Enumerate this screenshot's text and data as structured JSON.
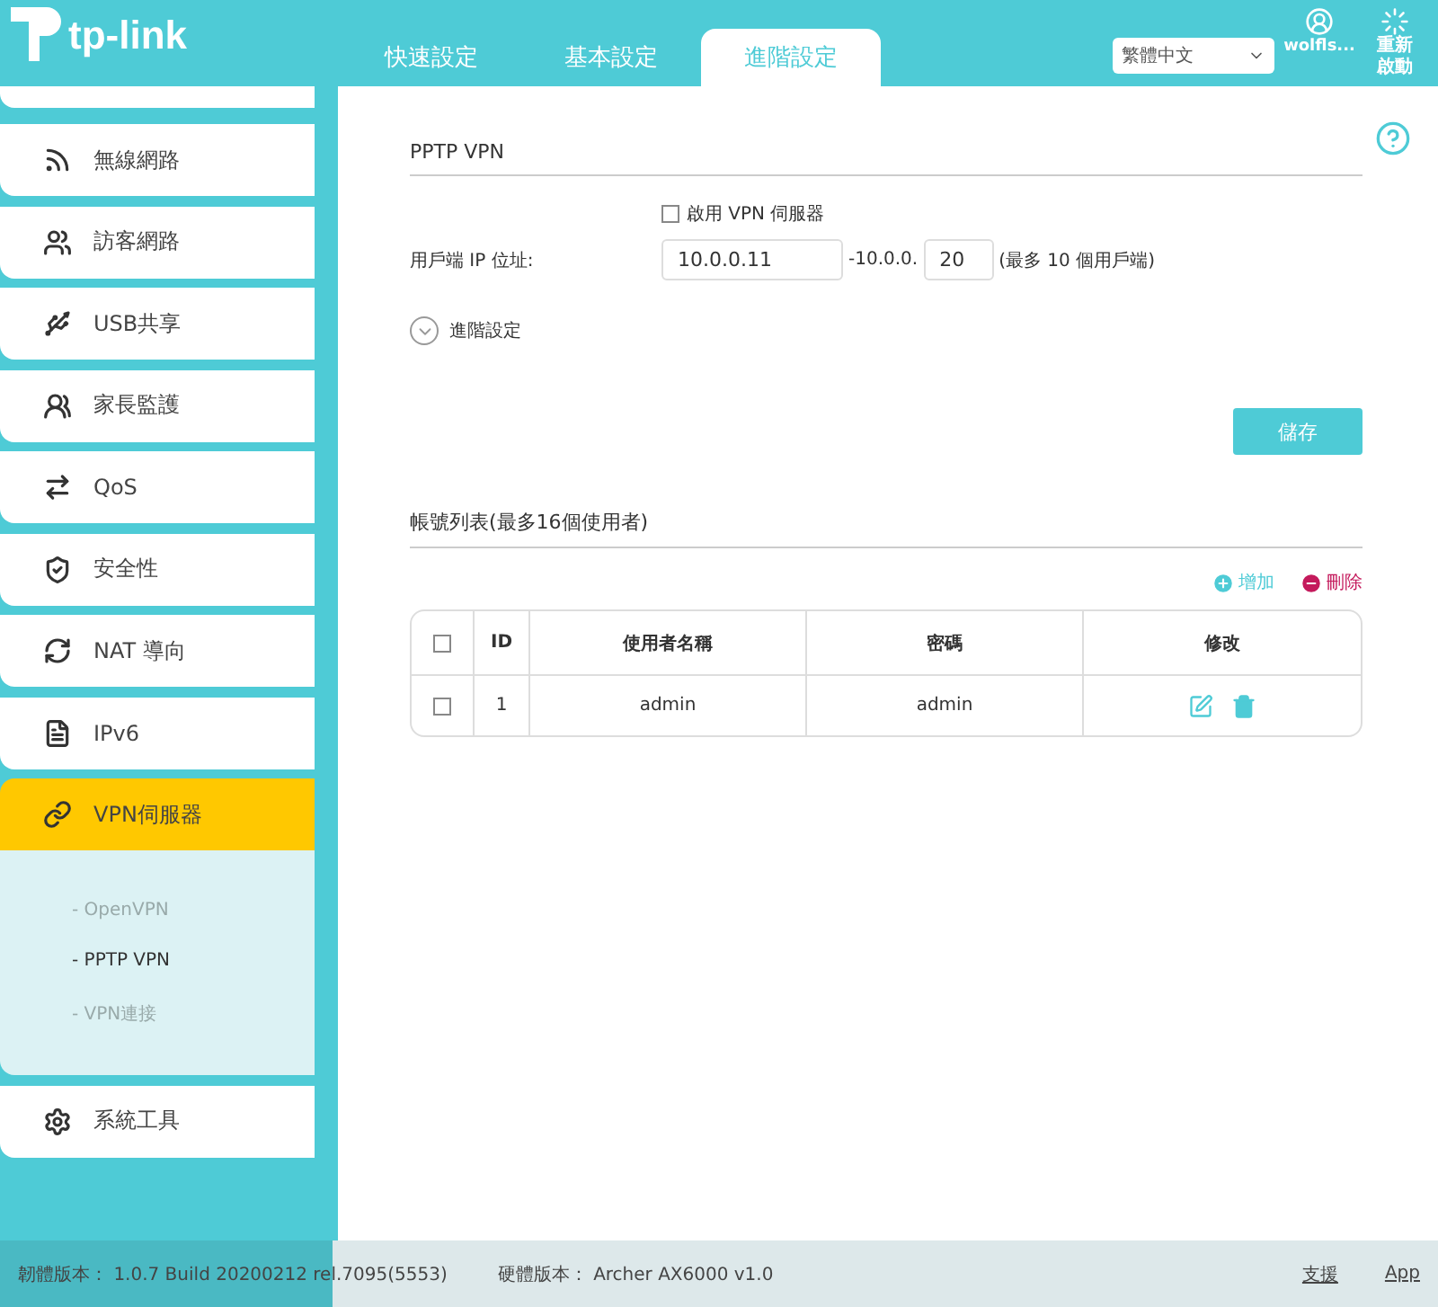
{
  "logo": {
    "text": "tp-link"
  },
  "nav_tabs": [
    {
      "label": "快速設定",
      "selected": false
    },
    {
      "label": "基本設定",
      "selected": false
    },
    {
      "label": "進階設定",
      "selected": true
    }
  ],
  "language_select": {
    "value": "繁體中文"
  },
  "header_actions": [
    {
      "kind": "account",
      "label": "wolfls..."
    },
    {
      "kind": "reboot",
      "label": "重新啟動"
    }
  ],
  "sidebar": {
    "items": [
      {
        "label": "無線網路",
        "selected": false
      },
      {
        "label": "訪客網路",
        "selected": false
      },
      {
        "label": "USB共享",
        "selected": false
      },
      {
        "label": "家長監護",
        "selected": false
      },
      {
        "label": "QoS",
        "selected": false
      },
      {
        "label": "安全性",
        "selected": false
      },
      {
        "label": "NAT 導向",
        "selected": false
      },
      {
        "label": "IPv6",
        "selected": false
      },
      {
        "label": "VPN伺服器",
        "selected": true,
        "expanded": true,
        "children": [
          {
            "label": "- OpenVPN",
            "selected": false
          },
          {
            "label": "- PPTP VPN",
            "selected": true
          },
          {
            "label": "- VPN連接",
            "selected": false
          }
        ]
      },
      {
        "label": "系統工具",
        "selected": false
      }
    ]
  },
  "pptp": {
    "title": "PPTP VPN",
    "enable_checkbox": {
      "label": "啟用 VPN 伺服器",
      "checked": false
    },
    "client_ip": {
      "label": "用戶端 IP 位址:",
      "start": "10.0.0.11",
      "range_prefix": "-10.0.0.",
      "end": "20",
      "note": "(最多 10 個用戶端)"
    },
    "advanced": {
      "label": "進階設定",
      "expanded": false
    },
    "save_button": "儲存"
  },
  "accounts": {
    "title": "帳號列表(最多16個使用者)",
    "add": "增加",
    "delete": "刪除",
    "columns": [
      "ID",
      "使用者名稱",
      "密碼",
      "修改"
    ],
    "header_checked": false,
    "rows": [
      {
        "checked": false,
        "id": "1",
        "username": "admin",
        "password": "admin"
      }
    ]
  },
  "footer": {
    "firmware_label": "韌體版本：",
    "firmware": "1.0.7 Build 20200212 rel.7095(5553)",
    "hardware_label": "硬體版本：",
    "hardware": "Archer AX6000 v1.0",
    "links": [
      "支援",
      "App"
    ]
  }
}
